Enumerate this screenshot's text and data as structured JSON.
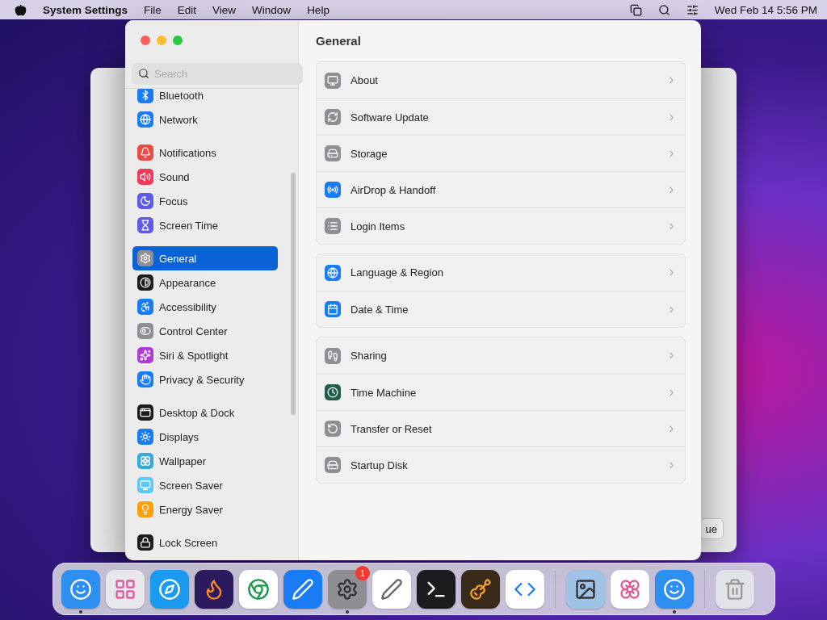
{
  "menu_bar": {
    "app_name": "System Settings",
    "menus": [
      "File",
      "Edit",
      "View",
      "Window",
      "Help"
    ],
    "clock": "Wed Feb 14  5:56 PM"
  },
  "background_window": {
    "button": "ue"
  },
  "window": {
    "search": {
      "placeholder": "Search"
    },
    "sidebar": {
      "groups": [
        [
          {
            "label": "Bluetooth",
            "color": "#1a7cf5",
            "selected": false
          },
          {
            "label": "Network",
            "color": "#1a7cf5",
            "selected": false
          }
        ],
        [
          {
            "label": "Notifications",
            "color": "#ef4a43",
            "selected": false
          },
          {
            "label": "Sound",
            "color": "#ee3b5b",
            "selected": false
          },
          {
            "label": "Focus",
            "color": "#5e5ce6",
            "selected": false
          },
          {
            "label": "Screen Time",
            "color": "#5e5ce6",
            "selected": false
          }
        ],
        [
          {
            "label": "General",
            "color": "#8e8e93",
            "selected": true
          },
          {
            "label": "Appearance",
            "color": "#1c1c1e",
            "selected": false
          },
          {
            "label": "Accessibility",
            "color": "#1a7cf5",
            "selected": false
          },
          {
            "label": "Control Center",
            "color": "#8e8e93",
            "selected": false
          },
          {
            "label": "Siri & Spotlight",
            "color": "#b03ad6",
            "selected": false
          },
          {
            "label": "Privacy & Security",
            "color": "#1a7cf5",
            "selected": false
          }
        ],
        [
          {
            "label": "Desktop & Dock",
            "color": "#1c1c1e",
            "selected": false
          },
          {
            "label": "Displays",
            "color": "#1a7cf5",
            "selected": false
          },
          {
            "label": "Wallpaper",
            "color": "#34aadc",
            "selected": false
          },
          {
            "label": "Screen Saver",
            "color": "#5ac8fa",
            "selected": false
          },
          {
            "label": "Energy Saver",
            "color": "#ff9f0a",
            "selected": false
          }
        ],
        [
          {
            "label": "Lock Screen",
            "color": "#1c1c1e",
            "selected": false
          }
        ]
      ]
    },
    "title": "General",
    "groups": [
      [
        {
          "label": "About",
          "color": "#8e8e93"
        },
        {
          "label": "Software Update",
          "color": "#8e8e93"
        },
        {
          "label": "Storage",
          "color": "#8e8e93"
        },
        {
          "label": "AirDrop & Handoff",
          "color": "#1a7cf5"
        },
        {
          "label": "Login Items",
          "color": "#8e8e93"
        }
      ],
      [
        {
          "label": "Language & Region",
          "color": "#1a7cf5"
        },
        {
          "label": "Date & Time",
          "color": "#1a7cf5"
        }
      ],
      [
        {
          "label": "Sharing",
          "color": "#8e8e93"
        },
        {
          "label": "Time Machine",
          "color": "#1f5e4a"
        },
        {
          "label": "Transfer or Reset",
          "color": "#8e8e93"
        },
        {
          "label": "Startup Disk",
          "color": "#8e8e93"
        }
      ]
    ]
  },
  "dock": {
    "items": [
      {
        "color": "#2d8ff0",
        "running": true
      },
      {
        "color": "#e8e8ec",
        "running": false
      },
      {
        "color": "#1a9bf0",
        "running": false
      },
      {
        "color": "#2b1a5e",
        "running": false
      },
      {
        "color": "#ffffff",
        "running": false
      },
      {
        "color": "#1a7cf5",
        "running": false
      },
      {
        "color": "#8e8e93",
        "running": true,
        "badge": "1"
      },
      {
        "color": "#ffffff",
        "running": false
      },
      {
        "color": "#1c1c1e",
        "running": false
      },
      {
        "color": "#3a2a1a",
        "running": false
      },
      {
        "color": "#ffffff",
        "running": false
      },
      {
        "color": "#9ec3e6",
        "running": false
      },
      {
        "color": "#ffffff",
        "running": false
      },
      {
        "color": "#2d8ff0",
        "running": true
      },
      {
        "color": "#e0e4e8",
        "running": false
      }
    ]
  }
}
